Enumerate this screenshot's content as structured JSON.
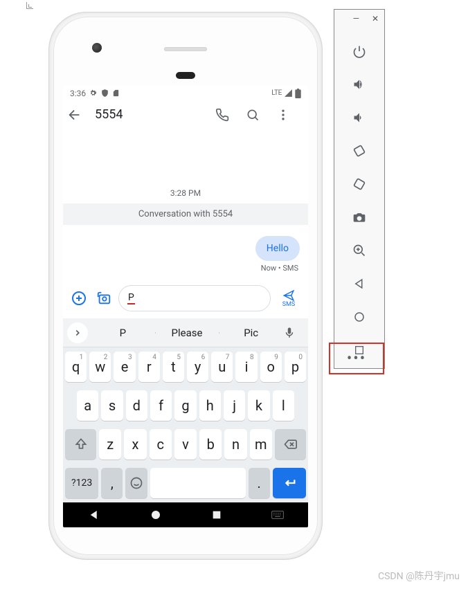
{
  "statusbar": {
    "time": "3:36",
    "net": "LTE"
  },
  "appbar": {
    "title": "5554"
  },
  "conversation": {
    "timestamp": "3:28 PM",
    "banner": "Conversation with 5554",
    "bubble": "Hello",
    "meta": "Now • SMS"
  },
  "compose": {
    "text": "P",
    "send_label": "SMS"
  },
  "suggestions": {
    "items": [
      "P",
      "Please",
      "Pic"
    ]
  },
  "keyboard": {
    "row1": [
      {
        "k": "q",
        "s": "1"
      },
      {
        "k": "w",
        "s": "2"
      },
      {
        "k": "e",
        "s": "3"
      },
      {
        "k": "r",
        "s": "4"
      },
      {
        "k": "t",
        "s": "5"
      },
      {
        "k": "y",
        "s": "6"
      },
      {
        "k": "u",
        "s": "7"
      },
      {
        "k": "i",
        "s": "8"
      },
      {
        "k": "o",
        "s": "9"
      },
      {
        "k": "p",
        "s": "0"
      }
    ],
    "row2": [
      "a",
      "s",
      "d",
      "f",
      "g",
      "h",
      "j",
      "k",
      "l"
    ],
    "row3": [
      "z",
      "x",
      "c",
      "v",
      "b",
      "n",
      "m"
    ],
    "sym": "?123",
    "comma": ",",
    "period": "."
  },
  "watermark": "CSDN @陈丹宇jmu"
}
